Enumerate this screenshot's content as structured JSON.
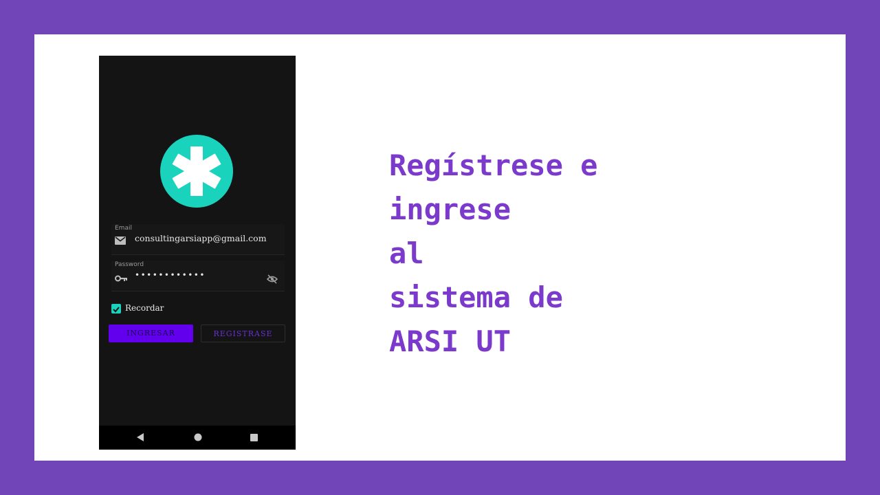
{
  "colors": {
    "frame": "#7145b7",
    "card": "#ffffff",
    "phone_bg": "#141414",
    "logo_teal": "#19d3bd",
    "primary_button": "#6200ee",
    "headline": "#7c3acc"
  },
  "login": {
    "logo_icon": "asterisk-medical-icon",
    "email": {
      "label": "Email",
      "icon": "mail-icon",
      "value": "consultingarsiapp@gmail.com"
    },
    "password": {
      "label": "Password",
      "icon": "key-icon",
      "value": "••••••••••••",
      "toggle_icon": "eye-off-icon"
    },
    "remember": {
      "label": "Recordar",
      "checked": true
    },
    "buttons": {
      "login": "INGRESAR",
      "register": "REGISTRASE"
    }
  },
  "navbar": {
    "icons": [
      "back-triangle-icon",
      "home-circle-icon",
      "recents-square-icon"
    ]
  },
  "headline": {
    "lines": [
      "Regístrese e",
      "ingrese",
      "al",
      "sistema de",
      "ARSI UT"
    ]
  }
}
